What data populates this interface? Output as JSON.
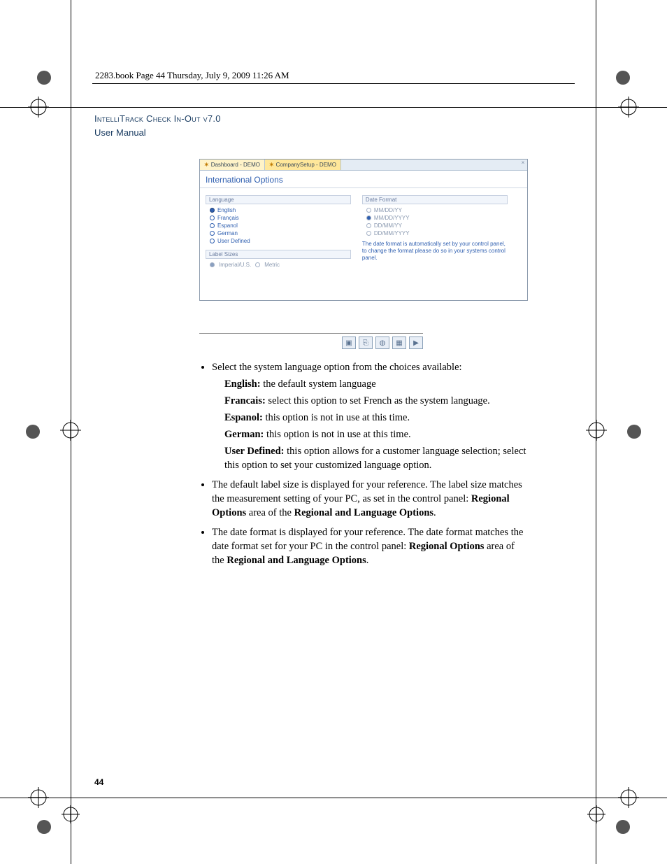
{
  "header_line": "2283.book  Page 44  Thursday, July 9, 2009  11:26 AM",
  "title": {
    "line1": "IntelliTrack Check In-Out v7.0",
    "line2": "User Manual"
  },
  "screenshot": {
    "tabs": [
      "Dashboard - DEMO",
      "CompanySetup - DEMO"
    ],
    "window_title": "International Options",
    "language_label": "Language",
    "languages": [
      {
        "label": "English",
        "selected": true
      },
      {
        "label": "Français",
        "selected": false
      },
      {
        "label": "Espanol",
        "selected": false
      },
      {
        "label": "German",
        "selected": false
      },
      {
        "label": "User Defined",
        "selected": false
      }
    ],
    "label_sizes_label": "Label Sizes",
    "label_sizes": {
      "imperial": "Imperial/U.S.",
      "metric": "Metric"
    },
    "date_format_label": "Date Format",
    "date_formats": [
      {
        "label": "MM/DD/YY",
        "selected": false
      },
      {
        "label": "MM/DD/YYYY",
        "selected": true
      },
      {
        "label": "DD/MM/YY",
        "selected": false
      },
      {
        "label": "DD/MM/YYYY",
        "selected": false
      }
    ],
    "date_note": "The date format is automatically set by your control panel, to change the format please do so in your systems control panel."
  },
  "icons": [
    "save-icon",
    "clone-icon",
    "globe-icon",
    "grid-icon",
    "play-icon"
  ],
  "icon_glyphs": [
    "▣",
    "⎘",
    "◍",
    "▦",
    "▶"
  ],
  "body": {
    "b1": "Select the system language option from the choices available:",
    "eng_k": "English:",
    "eng_v": " the default system language",
    "fra_k": "Francais:",
    "fra_v": " select this option to set French as the system language.",
    "esp_k": "Espanol:",
    "esp_v": " this option is not in use at this time.",
    "ger_k": "German:",
    "ger_v": " this option is not in use at this time.",
    "ud_k": "User Defined:",
    "ud_v": " this option allows for a customer language selection; select this option to set your customized language option.",
    "b2a": "The default label size is displayed for your reference. The label size matches the measurement setting of your PC, as set in the control panel: ",
    "b2b": "Regional Options",
    "b2c": " area of the ",
    "b2d": "Regional and Language Options",
    "b2e": ".",
    "b3a": "The date format is displayed for your reference. The date format matches the date format set for your PC in the control panel: ",
    "b3b": "Regional Options",
    "b3c": " area of the ",
    "b3d": "Regional and Language Options",
    "b3e": "."
  },
  "page_number": "44"
}
